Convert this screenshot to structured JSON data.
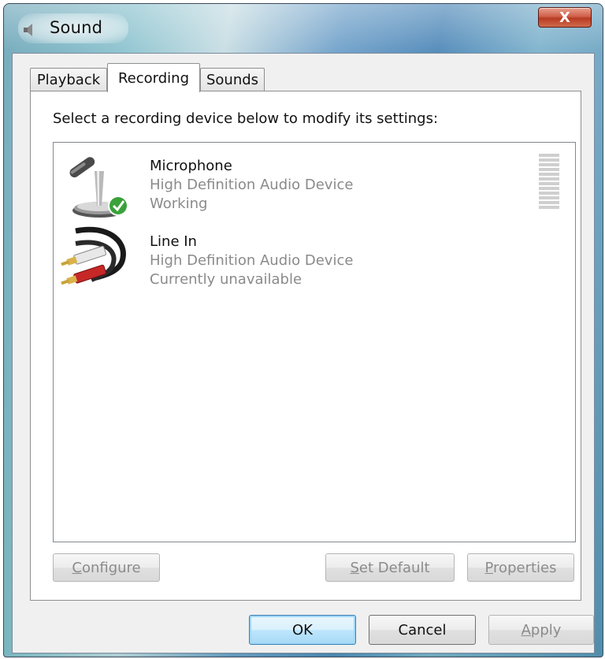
{
  "window": {
    "title": "Sound",
    "close_glyph": "X",
    "icon": "speaker-icon"
  },
  "tabs": [
    {
      "label": "Playback",
      "active": false
    },
    {
      "label": "Recording",
      "active": true
    },
    {
      "label": "Sounds",
      "active": false
    }
  ],
  "instruction": "Select a recording device below to modify its settings:",
  "devices": [
    {
      "name": "Microphone",
      "driver": "High Definition Audio Device",
      "status": "Working",
      "icon": "microphone-icon",
      "is_default": true,
      "level_fraction": 0
    },
    {
      "name": "Line In",
      "driver": "High Definition Audio Device",
      "status": "Currently unavailable",
      "icon": "rca-cable-icon",
      "is_default": false
    }
  ],
  "panel_buttons": {
    "configure_prefix": "",
    "configure_accel": "C",
    "configure_rest": "onfigure",
    "set_default_accel": "S",
    "set_default_rest": "et Default",
    "properties_accel": "P",
    "properties_rest": "roperties"
  },
  "dialog_buttons": {
    "ok": "OK",
    "cancel": "Cancel",
    "apply_accel": "A",
    "apply_rest": "pply"
  },
  "colors": {
    "close_button": "#c9452c",
    "default_check": "#3aa23a",
    "disabled_text": "#8b8b8b"
  }
}
